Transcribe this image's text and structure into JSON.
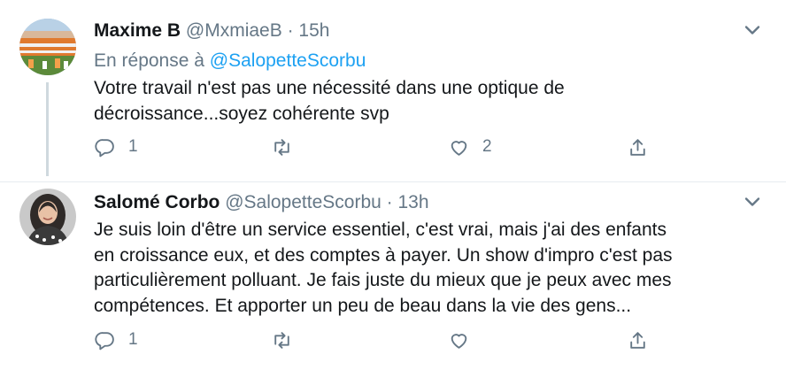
{
  "tweets": [
    {
      "author_name": "Maxime B",
      "handle": "@MxmiaeB",
      "separator": "·",
      "time": "15h",
      "reply_prefix": "En réponse à",
      "reply_to": "@SalopetteScorbu",
      "lines": [
        "Votre travail n'est pas une nécessité dans une optique de",
        "décroissance...soyez cohérente svp"
      ],
      "replies_count": "1",
      "retweets_count": "",
      "likes_count": "2"
    },
    {
      "author_name": "Salomé Corbo",
      "handle": "@SalopetteScorbu",
      "separator": "·",
      "time": "13h",
      "lines": [
        "Je suis loin d'être un service essentiel, c'est vrai, mais j'ai des enfants",
        "en croissance eux, et des comptes à payer. Un show d'impro c'est pas",
        "particulièrement polluant. Je fais juste du mieux que je peux avec mes",
        "compétences. Et apporter un peu de beau dans la vie des gens..."
      ],
      "replies_count": "1",
      "retweets_count": "",
      "likes_count": ""
    }
  ],
  "icons": {
    "reply": "reply-icon",
    "retweet": "retweet-icon",
    "like": "heart-icon",
    "share": "share-icon",
    "more": "chevron-down-icon"
  },
  "colors": {
    "text": "#14171a",
    "secondary": "#657786",
    "link": "#1da1f2",
    "thread_line": "#cfd9de"
  }
}
